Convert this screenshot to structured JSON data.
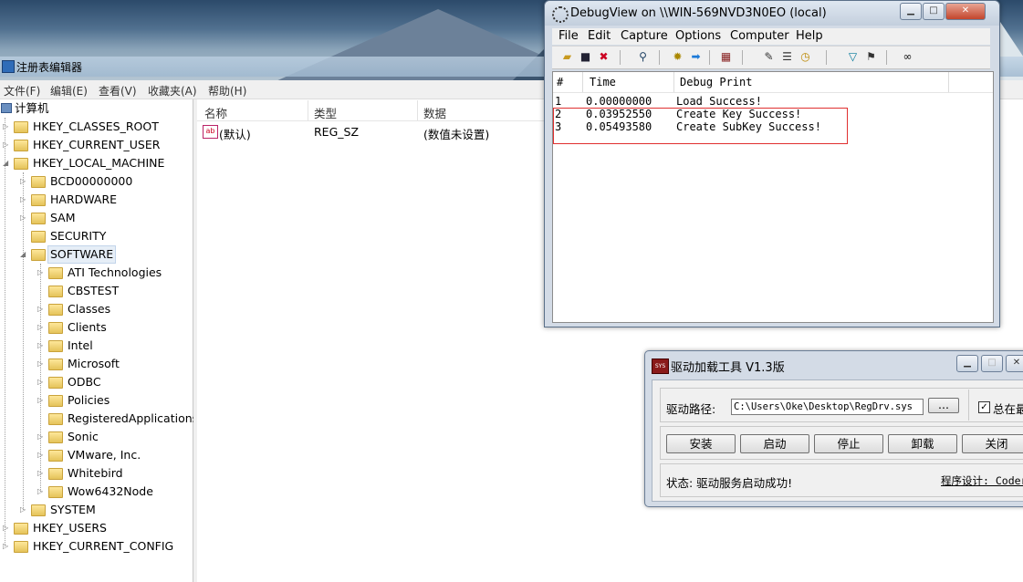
{
  "registry": {
    "title": "注册表编辑器",
    "menu": [
      "文件(F)",
      "编辑(E)",
      "查看(V)",
      "收藏夹(A)",
      "帮助(H)"
    ],
    "root": "计算机",
    "tree": {
      "hkcr": "HKEY_CLASSES_ROOT",
      "hkcu": "HKEY_CURRENT_USER",
      "hklm": "HKEY_LOCAL_MACHINE",
      "hklm_children": [
        "BCD00000000",
        "HARDWARE",
        "SAM",
        "SECURITY",
        "SOFTWARE"
      ],
      "software_children": [
        "ATI Technologies",
        "CBSTEST",
        "Classes",
        "Clients",
        "Intel",
        "Microsoft",
        "ODBC",
        "Policies",
        "RegisteredApplications",
        "Sonic",
        "VMware, Inc.",
        "Whitebird",
        "Wow6432Node"
      ],
      "system": "SYSTEM",
      "hku": "HKEY_USERS",
      "hkcc": "HKEY_CURRENT_CONFIG"
    },
    "columns": [
      "名称",
      "类型",
      "数据"
    ],
    "values": [
      {
        "name": "(默认)",
        "type": "REG_SZ",
        "data": "(数值未设置)"
      }
    ]
  },
  "debugview": {
    "title": "DebugView on \\\\WIN-569NVD3N0EO (local)",
    "menu": [
      "File",
      "Edit",
      "Capture",
      "Options",
      "Computer",
      "Help"
    ],
    "columns": [
      "#",
      "Time",
      "Debug Print"
    ],
    "rows": [
      {
        "n": "1",
        "time": "0.00000000",
        "msg": "Load Success!"
      },
      {
        "n": "2",
        "time": "0.03952550",
        "msg": "Create Key Success!"
      },
      {
        "n": "3",
        "time": "0.05493580",
        "msg": "Create SubKey Success!"
      }
    ],
    "highlight_color": "#e03030"
  },
  "driver": {
    "title": "驱动加载工具 V1.3版",
    "icon_text": "SYS",
    "path_label": "驱动路径:",
    "path_value": "C:\\Users\\Oke\\Desktop\\RegDrv.sys",
    "browse_label": "...",
    "always_top_label": "总在最前",
    "buttons": [
      "安装",
      "启动",
      "停止",
      "卸载",
      "关闭"
    ],
    "status": "状态: 驱动服务启动成功!",
    "credit": "程序设计: Coder"
  }
}
